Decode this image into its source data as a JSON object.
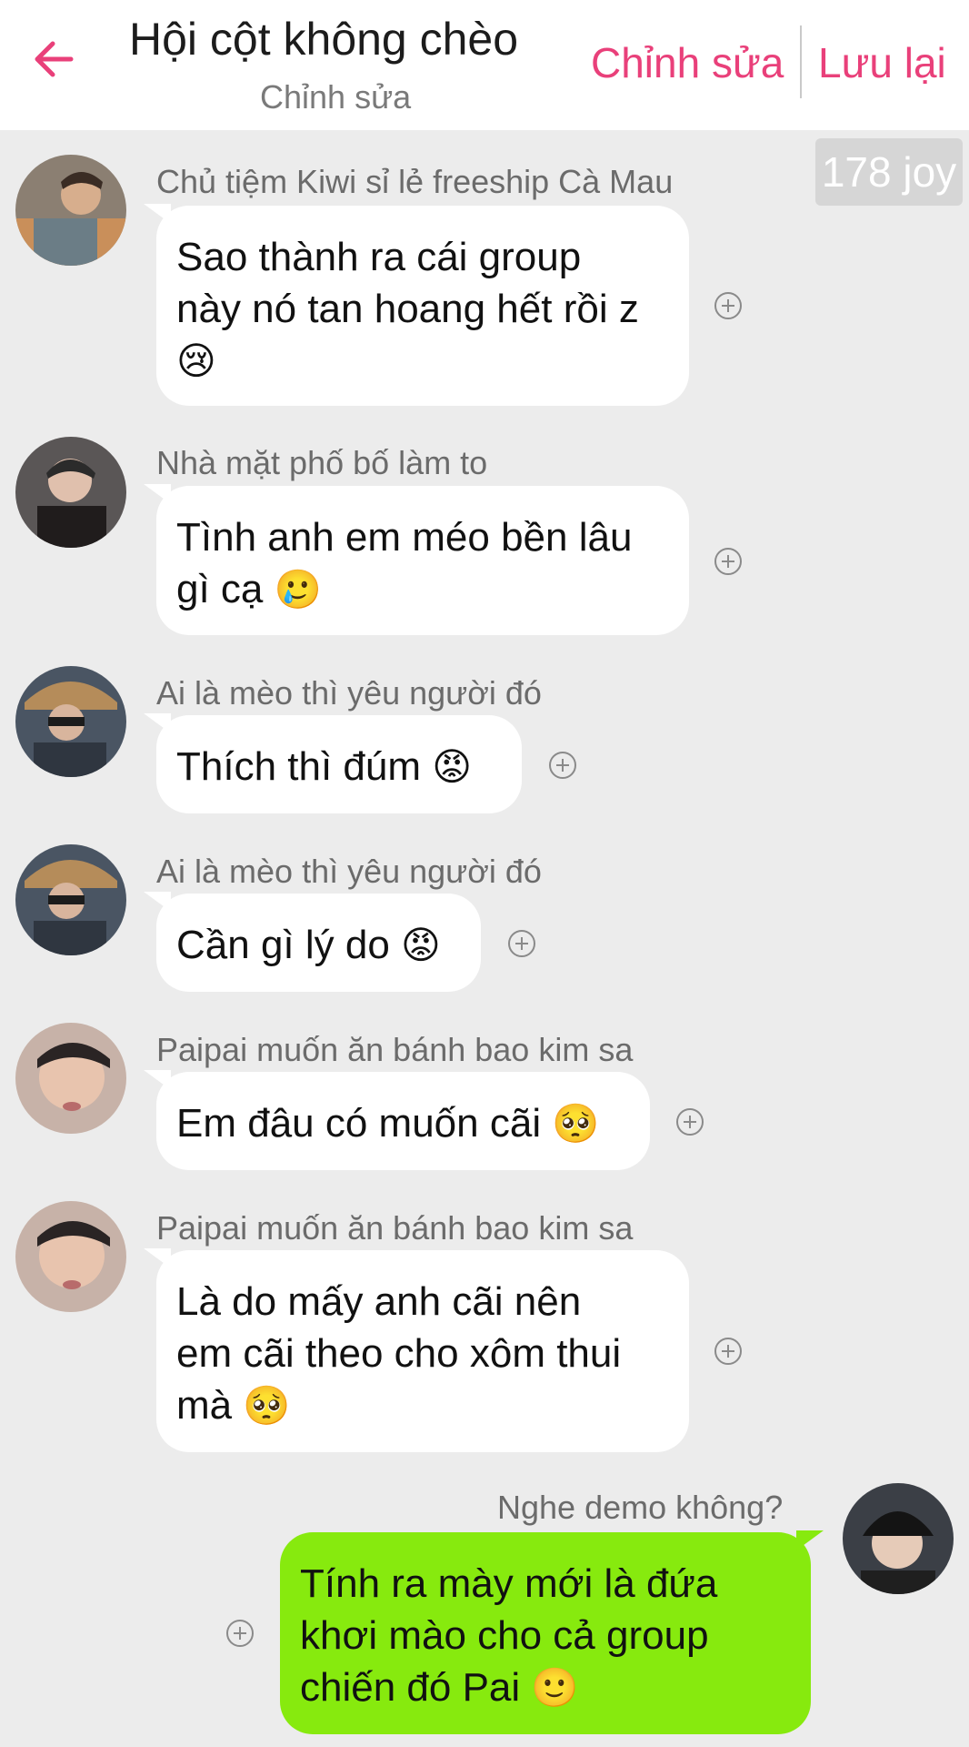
{
  "header": {
    "title": "Hội cột không chèo",
    "subtitle": "Chỉnh sửa",
    "edit_label": "Chỉnh sửa",
    "save_label": "Lưu lại",
    "accent": "#e9407a"
  },
  "joy_badge": "178 joy",
  "messages": [
    {
      "sender": "Chủ tiệm Kiwi sỉ lẻ freeship Cà Mau",
      "lines": [
        "Sao thành ra cái group",
        "này nó tan hoang hết rồi z",
        ""
      ],
      "emoji": "😢"
    },
    {
      "sender": "Nhà mặt phố bố làm to",
      "lines": [
        "Tình anh em méo bền lâu",
        "gì cạ "
      ],
      "emoji": "🥲"
    },
    {
      "sender": "Ai là mèo thì yêu người đó",
      "lines": [
        "Thích thì đúm "
      ],
      "emoji": "😡"
    },
    {
      "sender": "Ai là mèo thì yêu người đó",
      "lines": [
        "Cần gì lý do "
      ],
      "emoji": "😡"
    },
    {
      "sender": "Paipai muốn ăn bánh bao kim sa",
      "lines": [
        "Em đâu có muốn cãi "
      ],
      "emoji": "🥺"
    },
    {
      "sender": "Paipai muốn ăn bánh bao kim sa",
      "lines": [
        "Là do mấy anh cãi nên",
        "em cãi theo cho xôm thui",
        "mà "
      ],
      "emoji": "🥺"
    },
    {
      "sender": "Nghe demo không?",
      "lines": [
        "Tính ra mày mới là đứa",
        "khơi mào cho cả group",
        "chiến đó Pai "
      ],
      "emoji": "🙂",
      "mine": true
    }
  ],
  "colors": {
    "mine_bubble": "#87ea0e",
    "background": "#ececec"
  },
  "icons": {
    "back": "arrow-left-icon",
    "react": "plus-circle-icon"
  }
}
